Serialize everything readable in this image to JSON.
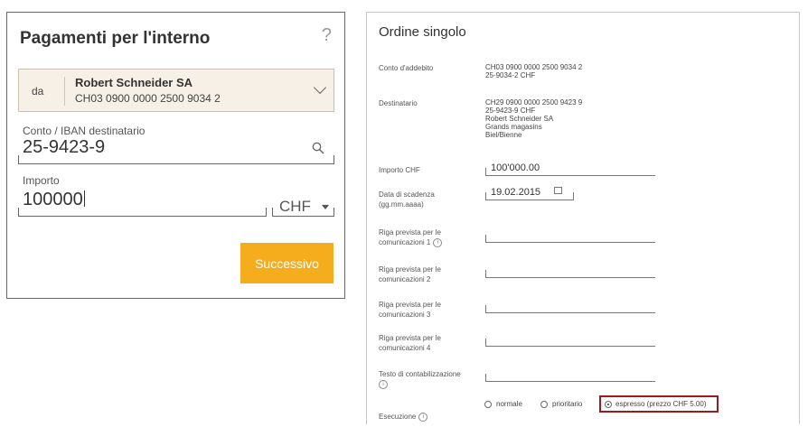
{
  "left": {
    "title": "Pagamenti per l'interno",
    "help_icon": "?",
    "from": {
      "label": "da",
      "name": "Robert Schneider SA",
      "account": "CH03 0900 0000 2500 9034 2"
    },
    "recipient": {
      "label": "Conto / IBAN destinatario",
      "value": "25-9423-9"
    },
    "amount": {
      "label": "Importo",
      "value": "100000",
      "currency": "CHF"
    },
    "next_button": "Successivo",
    "accent_color": "#f5ad1e"
  },
  "right": {
    "title": "Ordine singolo",
    "debit_account": {
      "label": "Conto d'addebito",
      "lines": [
        "CH03 0900 0000 2500 9034 2",
        "25-9034-2 CHF"
      ]
    },
    "recipient": {
      "label": "Destinatario",
      "lines": [
        "CH29 0900 0000 2500 9423 9",
        "25-9423-9 CHF",
        "Robert Schneider SA",
        "Grands magasins",
        "Biel/Bienne"
      ]
    },
    "amount": {
      "label": "Importo CHF",
      "value": "100'000.00"
    },
    "due_date": {
      "label_1": "Data di scadenza",
      "label_2": "(gg.mm.aaaa)",
      "value": "19.02.2015"
    },
    "comm_lines": [
      {
        "label_1": "Riga prevista per le",
        "label_2": "comunicazioni 1"
      },
      {
        "label_1": "Riga prevista per le",
        "label_2": "comunicazioni 2"
      },
      {
        "label_1": "Riga prevista per le",
        "label_2": "comunicazioni 3"
      },
      {
        "label_1": "Riga prevista per le",
        "label_2": "comunicazioni 4"
      }
    ],
    "booking_text": {
      "label": "Testo di contabilizzazione"
    },
    "execution": {
      "label": "Esecuzione",
      "options": [
        "normale",
        "prioritario",
        "espresso (prezzo CHF 5.00)"
      ],
      "selected": "espresso (prezzo CHF 5.00)",
      "highlight_color": "#9b1c1c"
    }
  }
}
